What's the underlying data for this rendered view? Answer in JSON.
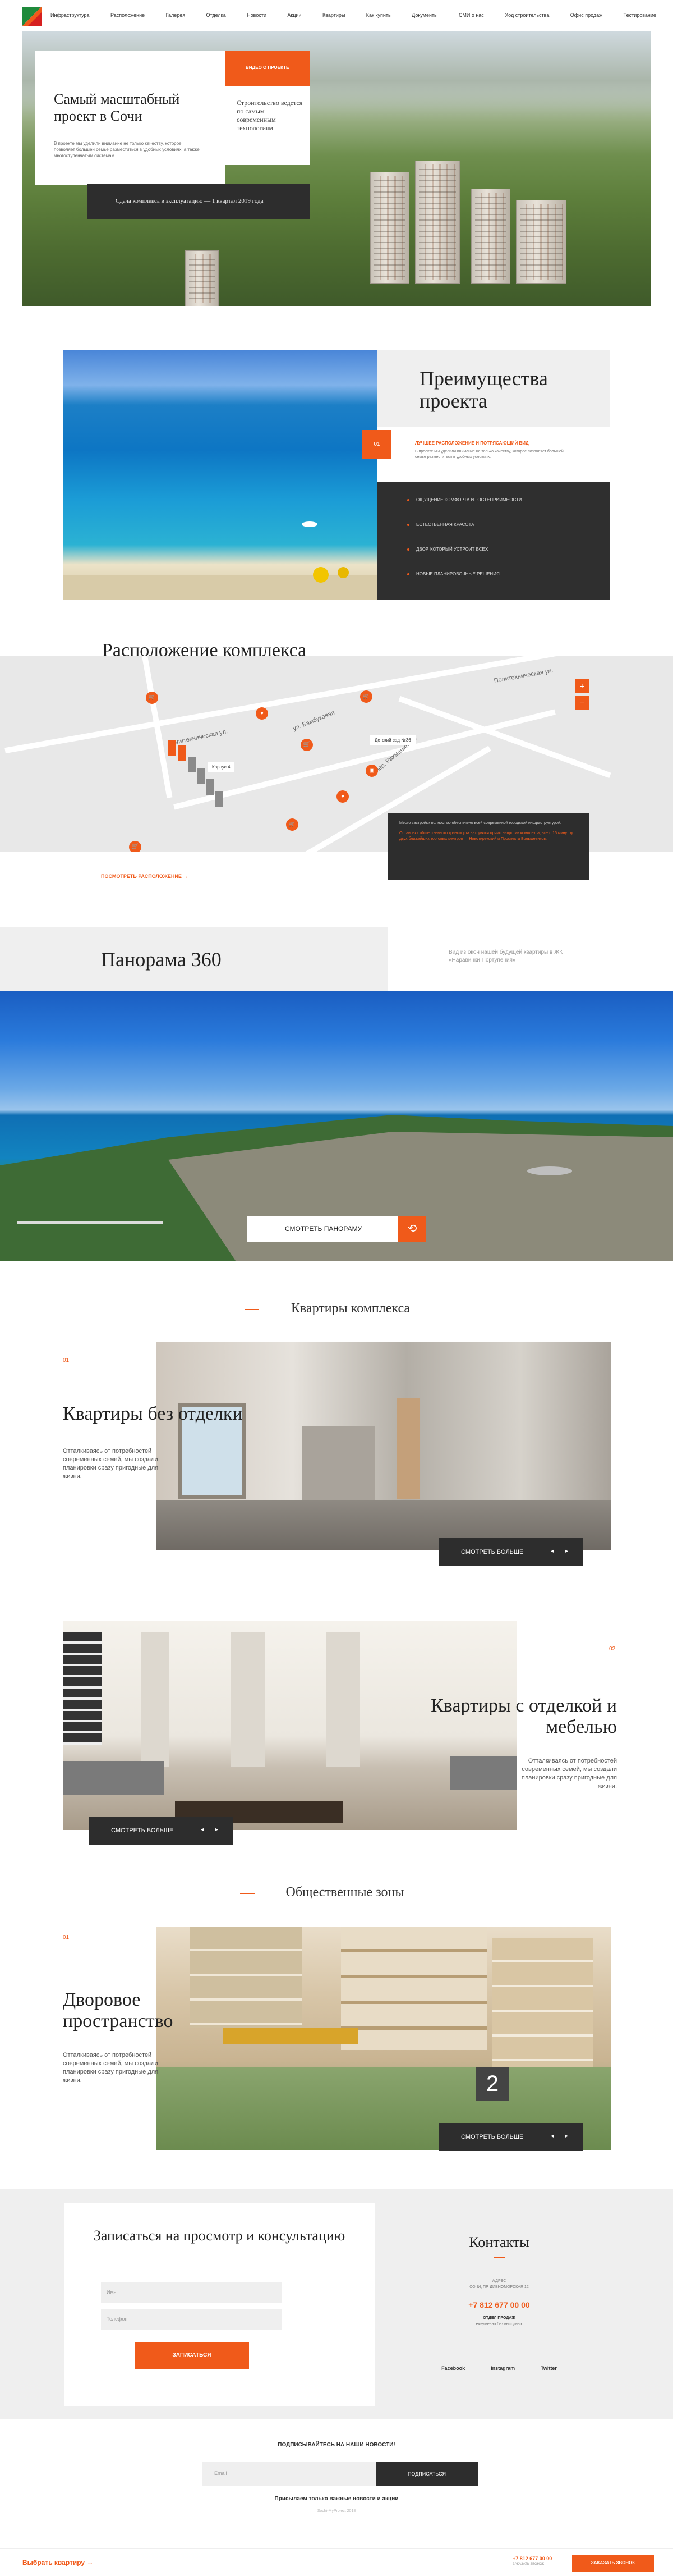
{
  "nav": {
    "items": [
      "Инфраструктура",
      "Расположение",
      "Галерея",
      "Отделка",
      "Новости",
      "Акции",
      "Квартиры",
      "Как купить",
      "Документы",
      "СМИ о нас",
      "Ход строительства",
      "Офис продаж",
      "Тестирование"
    ]
  },
  "hero": {
    "title": "Самый масштабный проект в Сочи",
    "text": "В проекте мы уделили внимание не только качеству, которое позволяет большей семье разместиться в удобных условиях, а также многоступенчатым системам.",
    "cta": "ВИДЕО О ПРОЕКТЕ",
    "side_text": "Строительство ведется по самым современным технологиям",
    "banner": "Сдача комплекса в эксплуатацию — 1 квартал 2019 года"
  },
  "advantages": {
    "title": "Преимущества проекта",
    "number": "01",
    "highlight": "ЛУЧШЕЕ РАСПОЛОЖЕНИЕ И ПОТРЯСАЮЩИЙ ВИД",
    "text": "В проекте мы уделили внимание не только качеству, которое позволяет большей семье разместиться в удобных условиях.",
    "list": [
      "ОЩУЩЕНИЕ КОМФОРТА И ГОСТЕПРИИМНОСТИ",
      "ЕСТЕСТВЕННАЯ КРАСОТА",
      "ДВОР, КОТОРЫЙ УСТРОИТ ВСЕХ",
      "НОВЫЕ ПЛАНИРОВОЧНЫЕ РЕШЕНИЯ"
    ]
  },
  "location": {
    "title": "Расположение комплекса",
    "streets": [
      "Политехническая ул.",
      "ул. Бамбуковая",
      "пер. Рахманинова",
      "Политехническая ул."
    ],
    "building_label": "Корпус 4",
    "kindergarten_label": "Детский сад №36",
    "card_text_1": "Место застройки полностью обеспечено всей современной городской инфраструктурой.",
    "card_text_2": "Остановки общественного транспорта находятся прямо напротив комплекса, всего 15 минут до двух ближайших торговых центров — Новотирекский и Проспекта Большевиков.",
    "link": "ПОСМОТРЕТЬ РАСПОЛОЖЕНИЕ",
    "zoom_in": "+",
    "zoom_out": "−"
  },
  "panorama": {
    "title": "Панорама 360",
    "side": "Вид из окон нашей будущей квартиры в ЖК «Наравинки Портупения»",
    "button": "СМОТРЕТЬ ПАНОРАМУ"
  },
  "apartments": {
    "section_title": "Квартиры комплекса",
    "items": [
      {
        "num": "01",
        "title": "Квартиры без отделки",
        "text": "Отталкиваясь от потребностей современных семей, мы создали планировки сразу пригодные для жизни.",
        "more": "СМОТРЕТЬ БОЛЬШЕ"
      },
      {
        "num": "02",
        "title": "Квартиры с отделкой и мебелью",
        "text": "Отталкиваясь от потребностей современных семей, мы создали планировки сразу пригодные для жизни.",
        "more": "СМОТРЕТЬ БОЛЬШЕ"
      }
    ]
  },
  "public": {
    "section_title": "Общественные зоны",
    "num": "01",
    "title": "Дворовое пространство",
    "text": "Отталкиваясь от потребностей современных семей, мы создали планировки сразу пригодные для жизни.",
    "more": "СМОТРЕТЬ БОЛЬШЕ",
    "slide_no": "2"
  },
  "form": {
    "title": "Записаться на просмотр и консультацию",
    "name_placeholder": "Имя",
    "phone_placeholder": "Телефон",
    "submit": "ЗАПИСАТЬСЯ"
  },
  "contacts": {
    "title": "Контакты",
    "address_label": "АДРЕС",
    "address": "СОЧИ, ПР. ДИВНОМОРСКАЯ 12",
    "phone": "+7 812 677 00 00",
    "hours_label": "ОТДЕЛ ПРОДАЖ",
    "hours": "ежедневно без выходных",
    "social": [
      "Facebook",
      "Instagram",
      "Twitter"
    ]
  },
  "newsletter": {
    "title": "ПОДПИСЫВАЙТЕСЬ НА НАШИ НОВОСТИ!",
    "placeholder": "Email",
    "button": "ПОДПИСАТЬСЯ",
    "subtitle": "Присылаем только важные новости и акции",
    "copyright": "Sochi-MyProject 2018"
  },
  "footer": {
    "choose": "Выбрать квартиру",
    "phone": "+7 812 677 00 00",
    "callback_label": "ЗАКАЗАТЬ ЗВОНОК",
    "callback": "ЗАКАЗАТЬ ЗВОНОК"
  },
  "colors": {
    "accent": "#f05a1a",
    "dark": "#2d2d2d",
    "light": "#efefef"
  }
}
